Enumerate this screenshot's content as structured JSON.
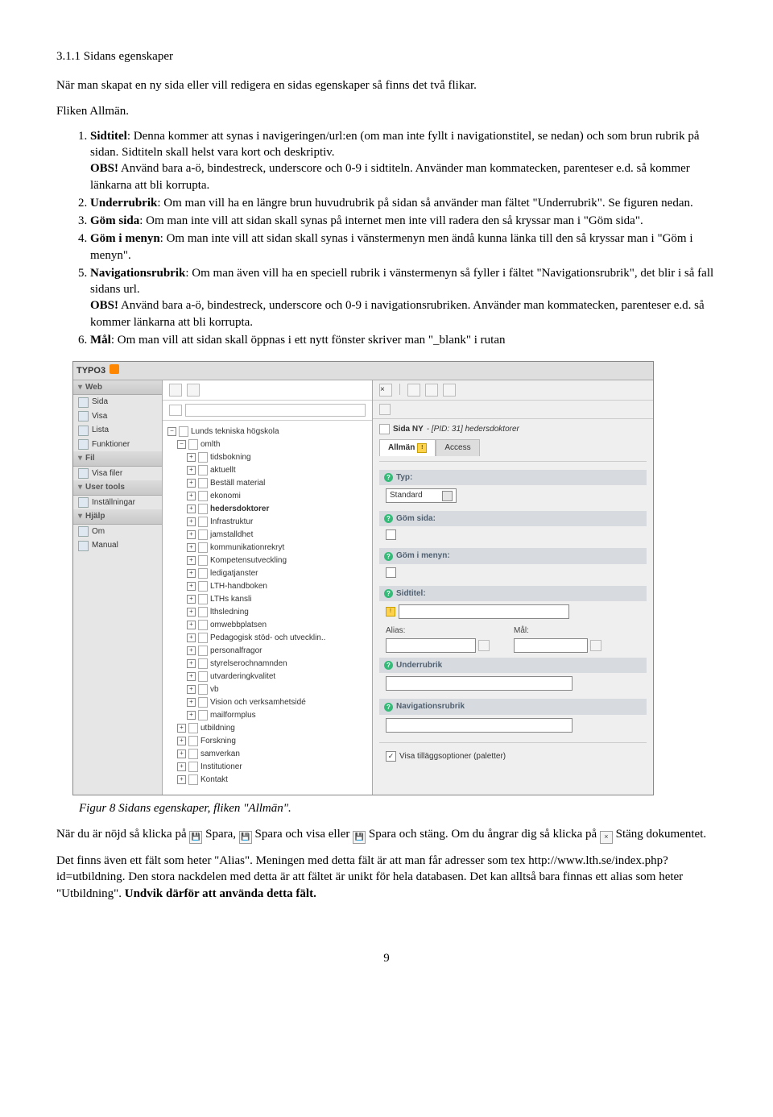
{
  "doc": {
    "section_num": "3.1.1 Sidans egenskaper",
    "intro": "När man skapat en ny sida eller vill redigera en sidas egenskaper så finns det två flikar.",
    "tab_line": "Fliken Allmän.",
    "li1": {
      "lead": "Sidtitel",
      "body": ": Denna kommer att synas i navigeringen/url:en (om man inte fyllt i navigationstitel, se nedan) och som brun rubrik på sidan. Sidtiteln skall helst vara kort och deskriptiv.",
      "obs": "OBS!",
      "obs_body": " Använd bara a-ö, bindestreck, underscore och 0-9 i sidtiteln. Använder man kommatecken, parenteser e.d. så kommer länkarna att bli korrupta."
    },
    "li2": {
      "lead": "Underrubrik",
      "body": ": Om man vill ha en längre brun huvudrubrik på sidan så använder man fältet \"Underrubrik\". Se figuren nedan."
    },
    "li3": {
      "lead": "Göm sida",
      "body": ": Om man inte vill att sidan skall synas på internet men inte vill radera den så kryssar man i \"Göm sida\"."
    },
    "li4": {
      "lead": "Göm i menyn",
      "body": ": Om man inte vill att sidan skall synas i vänstermenyn men ändå kunna länka till den så kryssar man i \"Göm i menyn\"."
    },
    "li5": {
      "lead": "Navigationsrubrik",
      "body": ": Om man även vill ha en speciell rubrik i vänstermenyn så fyller i fältet \"Navigationsrubrik\", det blir i så fall sidans url.",
      "obs": "OBS!",
      "obs_body": " Använd bara a-ö, bindestreck, underscore och 0-9 i navigationsrubriken. Använder man kommatecken, parenteser e.d. så kommer länkarna att bli korrupta."
    },
    "li6": {
      "lead": "Mål",
      "body": ": Om man vill att sidan skall öppnas i ett nytt fönster skriver man \"_blank\" i rutan"
    },
    "fig_caption": "Figur 8 Sidans egenskaper, fliken \"Allmän\".",
    "after1a": "När du är nöjd så klicka på ",
    "after_save": " Spara, ",
    "after_saveview": " Spara och visa eller ",
    "after_saveclose": " Spara och stäng. Om du ångrar dig så klicka på ",
    "after_close": " Stäng dokumentet.",
    "alias_p1": "Det finns även ett fält som heter \"Alias\". Meningen med detta fält är att man får adresser som tex http://www.lth.se/index.php?id=utbildning. Den stora nackdelen med detta är att fältet är unikt för hela databasen. Det kan alltså bara finnas ett alias som heter \"Utbildning\". ",
    "alias_bold": "Undvik därför att använda detta fält.",
    "page_num": "9"
  },
  "shot": {
    "logo": "TYPO3",
    "left": {
      "web_hdr": "Web",
      "web_items": [
        "Sida",
        "Visa",
        "Lista",
        "Funktioner"
      ],
      "fil_hdr": "Fil",
      "fil_items": [
        "Visa filer"
      ],
      "ut_hdr": "User tools",
      "ut_items": [
        "Inställningar"
      ],
      "help_hdr": "Hjälp",
      "help_items": [
        "Om",
        "Manual"
      ]
    },
    "tree": {
      "root": "Lunds tekniska högskola",
      "omlth": "omlth",
      "items": [
        "tidsbokning",
        "aktuellt",
        "Beställ material",
        "ekonomi",
        "hedersdoktorer",
        "Infrastruktur",
        "jamstalldhet",
        "kommunikationrekryt",
        "Kompetensutveckling",
        "ledigatjanster",
        "LTH-handboken",
        "LTHs kansli",
        "lthsledning",
        "omwebbplatsen",
        "Pedagogisk stöd- och utvecklin..",
        "personalfragor",
        "styrelserochnamnden",
        "utvarderingkvalitet",
        "vb",
        "Vision och verksamhetsidé",
        "mailformplus"
      ],
      "below": [
        "utbildning",
        "Forskning",
        "samverkan",
        "Institutioner",
        "Kontakt"
      ],
      "bold_idx": 4
    },
    "form": {
      "pid_line_a": "Sida NY",
      "pid_line_b": " - [PID: 31] hedersdoktorer",
      "tab_allman": "Allmän",
      "tab_access": "Access",
      "f_typ": "Typ:",
      "sel_standard": "Standard",
      "f_gom_sida": "Göm sida:",
      "f_gom_meny": "Göm i menyn:",
      "f_sidtitel": "Sidtitel:",
      "lbl_alias": "Alias:",
      "lbl_mal": "Mål:",
      "f_underrubrik": "Underrubrik",
      "f_navrubrik": "Navigationsrubrik",
      "opt_line": "Visa tilläggsoptioner (paletter)"
    }
  }
}
